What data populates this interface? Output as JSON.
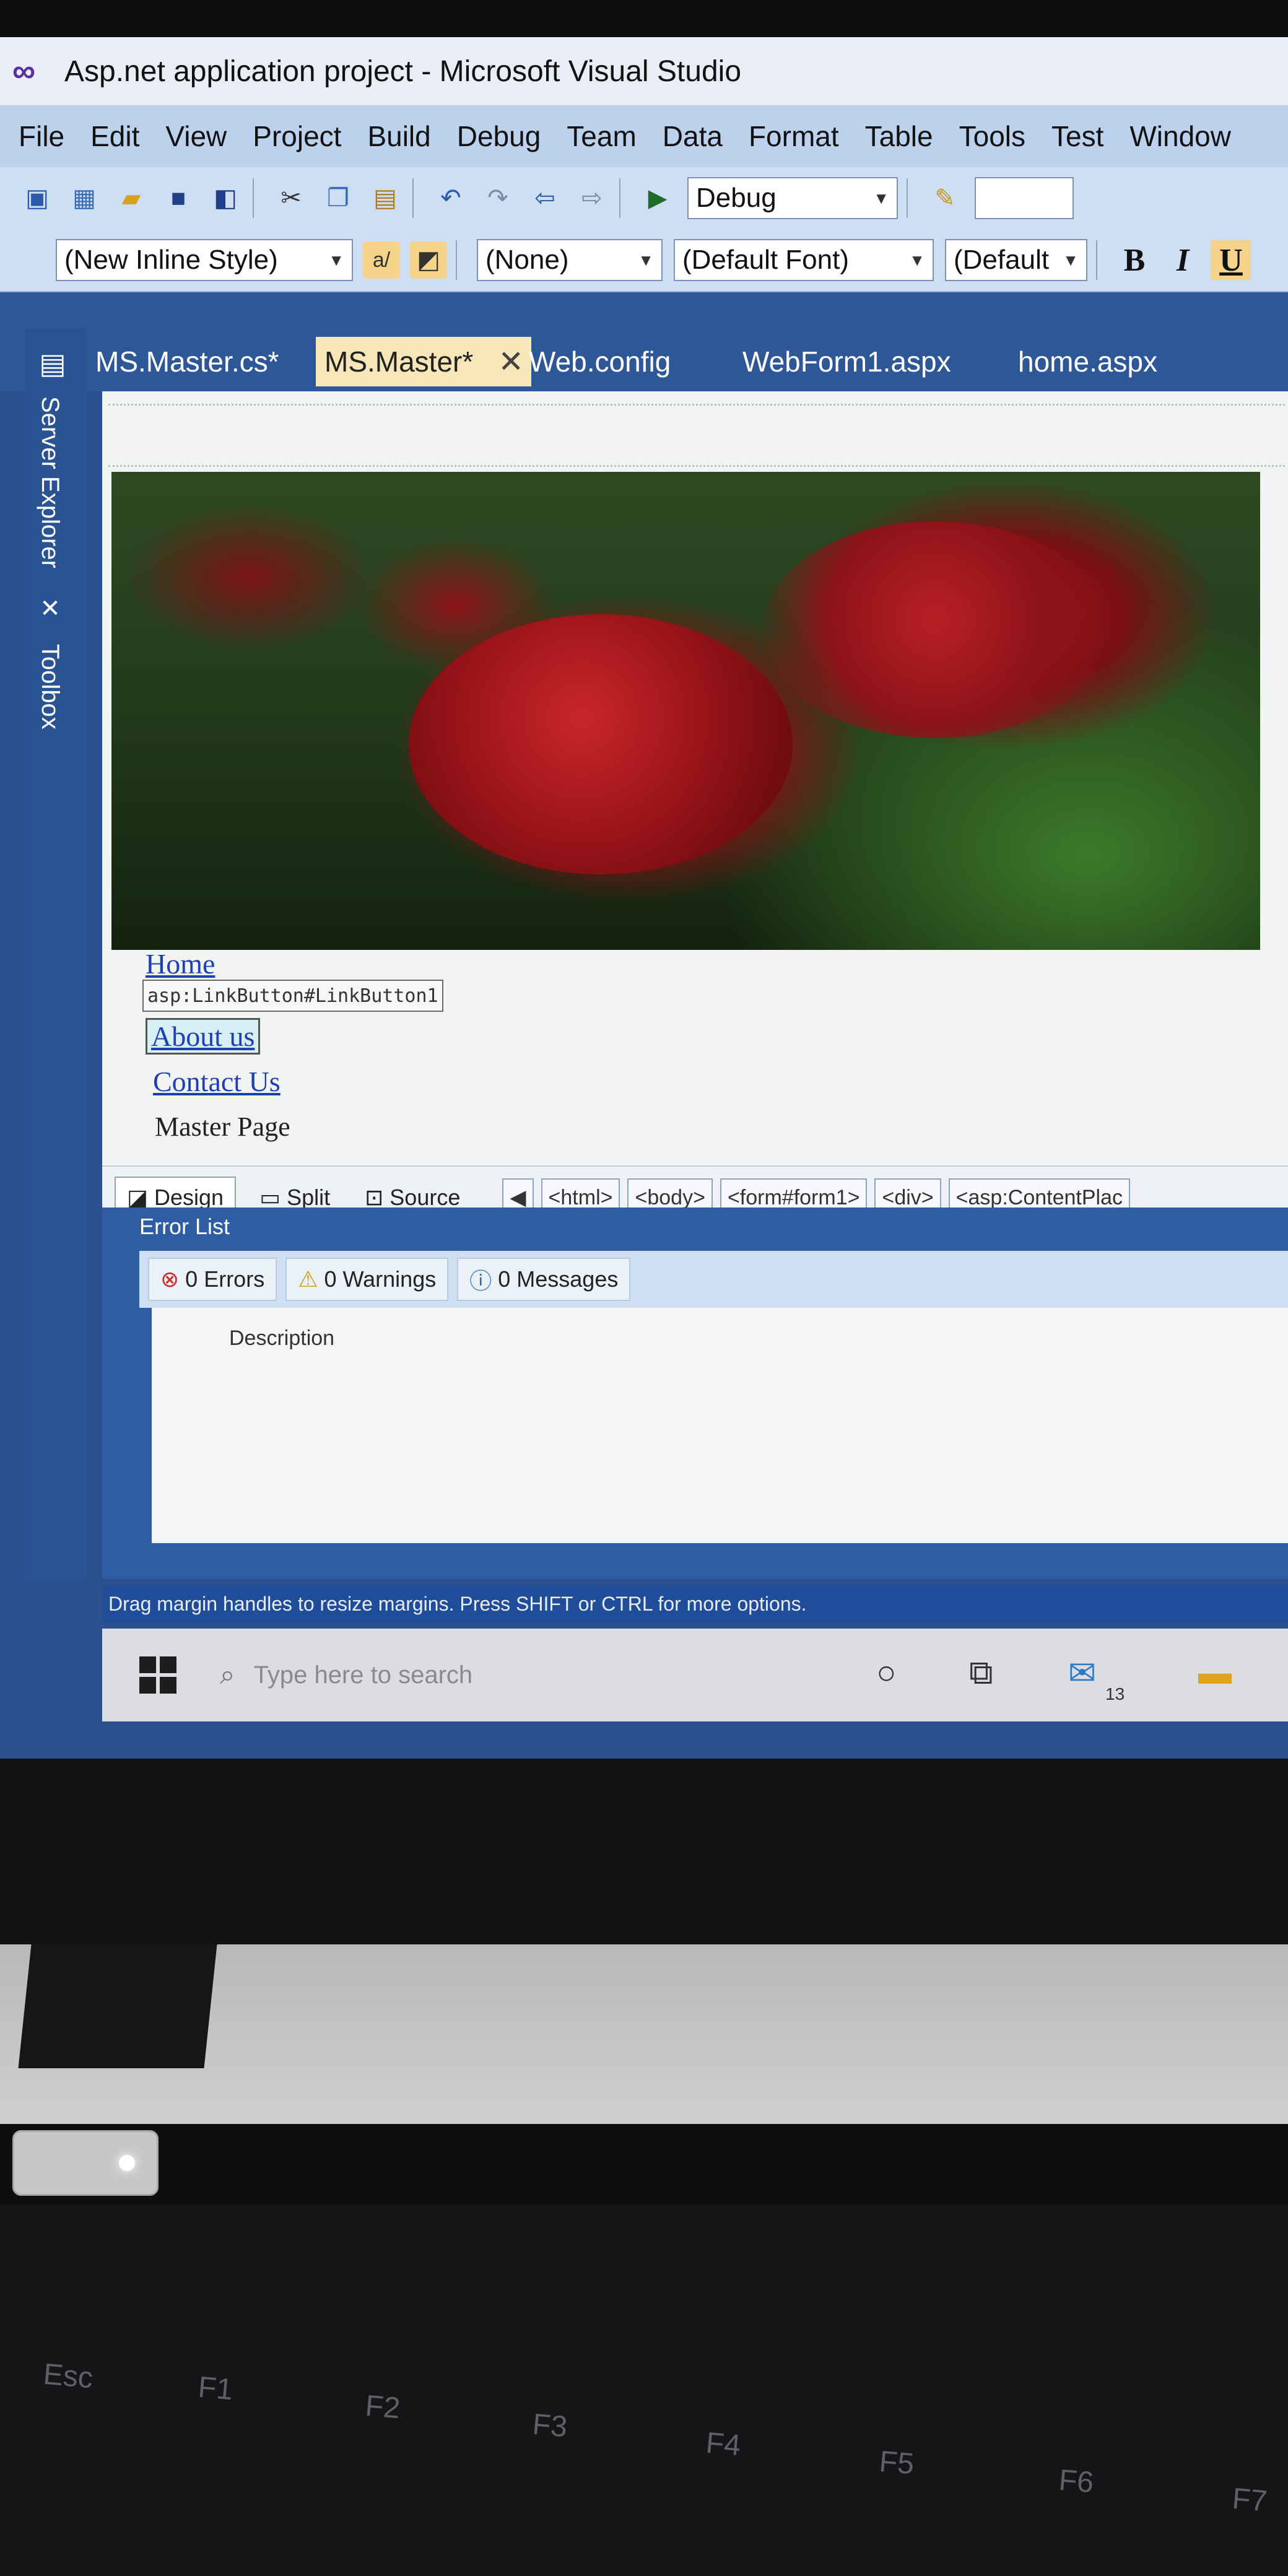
{
  "window": {
    "title": "Asp.net application project - Microsoft Visual Studio",
    "logo_icon": "visual-studio-infinity-icon"
  },
  "menu": [
    "File",
    "Edit",
    "View",
    "Project",
    "Build",
    "Debug",
    "Team",
    "Data",
    "Format",
    "Table",
    "Tools",
    "Test",
    "Window"
  ],
  "toolbar1": {
    "config_value": "Debug"
  },
  "toolbar2": {
    "style_value": "(New Inline Style)",
    "block_value": "(None)",
    "font_value": "(Default Font)",
    "size_value": "(Default",
    "bold": "B",
    "italic": "I",
    "underline": "U"
  },
  "doc_tabs": {
    "tab1": "MS.Master.cs*",
    "tab2": "MS.Master*",
    "tab3": "Web.config",
    "tab4": "WebForm1.aspx",
    "tab5": "home.aspx",
    "active": "MS.Master*"
  },
  "sidebar": {
    "server_explorer": "Server Explorer",
    "toolbox": "Toolbox"
  },
  "designer": {
    "links": {
      "home": "Home",
      "about": "About us",
      "contact": "Contact Us"
    },
    "tag_hint": "asp:LinkButton#LinkButton1",
    "master_label": "Master Page",
    "image_subject": "red roses"
  },
  "view_bar": {
    "design": "Design",
    "split": "Split",
    "source": "Source",
    "crumbs": [
      "<html>",
      "<body>",
      "<form#form1>",
      "<div>",
      "<asp:ContentPlac"
    ]
  },
  "error_list": {
    "title": "Error List",
    "errors": "0 Errors",
    "warnings": "0 Warnings",
    "messages": "0 Messages",
    "col_description": "Description"
  },
  "status": {
    "text": "Drag margin handles to resize margins. Press SHIFT or CTRL for more options."
  },
  "taskbar": {
    "search_placeholder": "Type here to search",
    "mail_badge": "13"
  },
  "keyboard": [
    "Esc",
    "F1",
    "F2",
    "F3",
    "F4",
    "F5",
    "F6",
    "F7"
  ],
  "colors": {
    "vs_blue": "#2e5797",
    "active_tab": "#f7e6b8",
    "link": "#1e40b4"
  }
}
